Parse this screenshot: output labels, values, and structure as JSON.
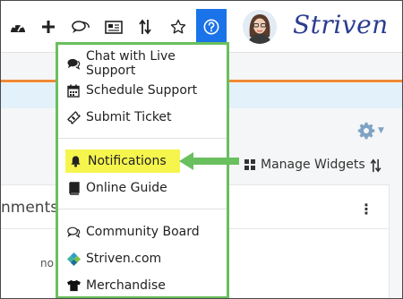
{
  "brand": {
    "name": "Striven"
  },
  "toolbar": {
    "icons": [
      "dashboard-icon",
      "plus-icon",
      "chat-icon",
      "newspaper-icon",
      "sort-icon",
      "star-icon",
      "help-icon"
    ]
  },
  "colors": {
    "accent_blue": "#1a73e8",
    "highlight_green": "#6abf5e",
    "highlight_yellow": "#f6f54d",
    "orange_strip": "#f08a35",
    "brand_navy": "#2b3c8f"
  },
  "help_menu": {
    "items": [
      {
        "label": "Chat with Live Support",
        "icon": "chat-bubbles-icon"
      },
      {
        "label": "Schedule Support",
        "icon": "calendar-icon"
      },
      {
        "label": "Submit Ticket",
        "icon": "ticket-icon"
      },
      {
        "label": "Notifications",
        "icon": "bell-icon",
        "highlighted": true
      },
      {
        "label": "Online Guide",
        "icon": "book-icon"
      },
      {
        "label": "Community Board",
        "icon": "comments-icon"
      },
      {
        "label": "Striven.com",
        "icon": "striven-logo-icon"
      },
      {
        "label": "Merchandise",
        "icon": "tshirt-icon"
      }
    ]
  },
  "page": {
    "manage_widgets_label": "Manage Widgets",
    "widget_title": "nments",
    "widget_note": "no"
  }
}
